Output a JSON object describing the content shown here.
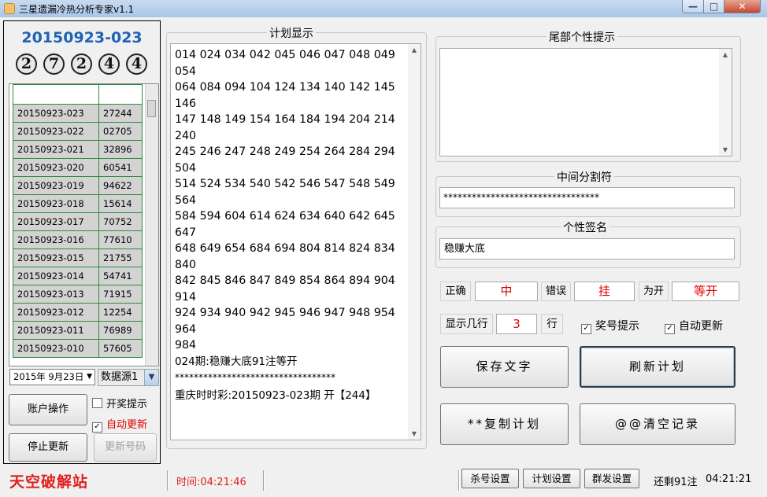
{
  "window": {
    "title": "三星遗漏冷热分析专家v1.1",
    "min_glyph": "—",
    "max_glyph": "□",
    "close_glyph": "✕"
  },
  "left": {
    "period": "20150923-023",
    "balls": [
      "2",
      "7",
      "2",
      "4",
      "4"
    ],
    "rows": [
      {
        "issue": "20150923-023",
        "num": "27244"
      },
      {
        "issue": "20150923-022",
        "num": "02705"
      },
      {
        "issue": "20150923-021",
        "num": "32896"
      },
      {
        "issue": "20150923-020",
        "num": "60541"
      },
      {
        "issue": "20150923-019",
        "num": "94622"
      },
      {
        "issue": "20150923-018",
        "num": "15614"
      },
      {
        "issue": "20150923-017",
        "num": "70752"
      },
      {
        "issue": "20150923-016",
        "num": "77610"
      },
      {
        "issue": "20150923-015",
        "num": "21755"
      },
      {
        "issue": "20150923-014",
        "num": "54741"
      },
      {
        "issue": "20150923-013",
        "num": "71915"
      },
      {
        "issue": "20150923-012",
        "num": "12254"
      },
      {
        "issue": "20150923-011",
        "num": "76989"
      },
      {
        "issue": "20150923-010",
        "num": "57605"
      }
    ],
    "date": "2015年  9月23日",
    "source": "数据源1",
    "account_btn": "账户操作",
    "stop_btn": "停止更新",
    "refresh_num_btn": "更新号码",
    "cb_lottery_tip": "开奖提示",
    "cb_auto_update": "自动更新"
  },
  "plan": {
    "title": "计划显示",
    "lines": [
      "014 024 034 042 045 046 047 048 049 054",
      "064 084 094 104 124 134 140 142 145 146",
      "147 148 149 154 164 184 194 204 214 240",
      "245 246 247 248 249 254 264 284 294 504",
      "514 524 534 540 542 546 547 548 549 564",
      "584 594 604 614 624 634 640 642 645 647",
      "648 649 654 684 694 804 814 824 834 840",
      "842 845 846 847 849 854 864 894 904 914",
      "924 934 940 942 945 946 947 948 954 964",
      "984",
      "024期:稳赚大底91注等开",
      "**********************************",
      "重庆时时彩:20150923-023期 开【244】"
    ]
  },
  "right": {
    "tail_title": "尾部个性提示",
    "sep_title": "中间分割符",
    "sep_value": "*********************************",
    "sig_title": "个性签名",
    "sig_value": "稳赚大底",
    "correct_label": "正确",
    "correct_value": "中",
    "wrong_label": "错误",
    "wrong_value": "挂",
    "open_label": "为开",
    "open_value": "等开",
    "rows_label": "显示几行",
    "rows_value": "3",
    "rows_unit": "行",
    "cb_prize_tip": "奖号提示",
    "cb_auto_update": "自动更新",
    "save_btn": "保存文字",
    "refresh_plan_btn": "刷新计划",
    "copy_plan_btn": "**复制计划",
    "clear_btn": "@@清空记录"
  },
  "status": {
    "brand": "天空破解站",
    "time": "时间:04:21:46",
    "kill_btn": "杀号设置",
    "plan_btn": "计划设置",
    "group_btn": "群发设置",
    "remaining": "还剩91注",
    "clock": "04:21:21"
  },
  "colors": {
    "accent_blue": "#1f63b5",
    "red": "#e00000",
    "grid_green": "#2e8b3e",
    "cell_gray": "#d3d3d3"
  }
}
